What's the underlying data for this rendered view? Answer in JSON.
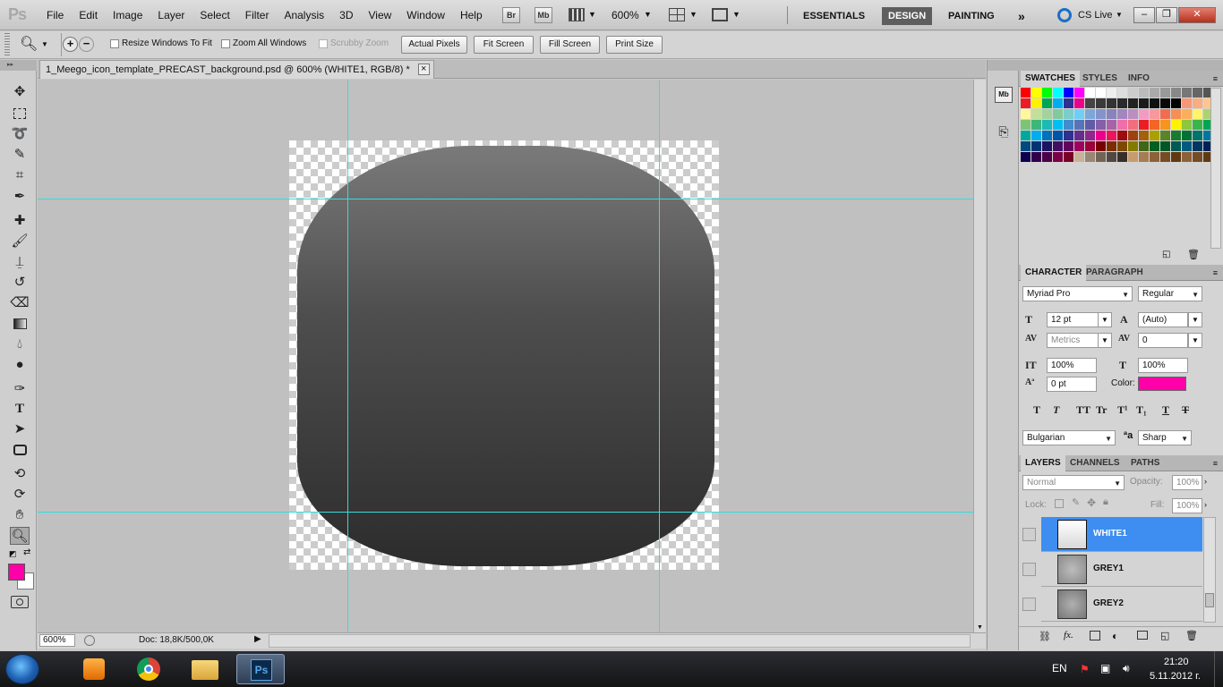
{
  "menubar": {
    "logo": "Ps",
    "menus": [
      "File",
      "Edit",
      "Image",
      "Layer",
      "Select",
      "Filter",
      "Analysis",
      "3D",
      "View",
      "Window",
      "Help"
    ],
    "bridge_btn": "Br",
    "minibridge_btn": "Mb",
    "zoom": "600%",
    "workspaces": [
      "ESSENTIALS",
      "DESIGN",
      "PAINTING"
    ],
    "more": "»",
    "cslive": "CS Live"
  },
  "options": {
    "resize_windows": "Resize Windows To Fit",
    "zoom_all": "Zoom All Windows",
    "scrubby_zoom": "Scrubby Zoom",
    "actual_pixels": "Actual Pixels",
    "fit_screen": "Fit Screen",
    "fill_screen": "Fill Screen",
    "print_size": "Print Size"
  },
  "document": {
    "tab_title": "1_Meego_icon_template_PRECAST_background.psd @ 600% (WHITE1, RGB/8) *",
    "close": "×"
  },
  "statusbar": {
    "zoom": "600%",
    "doc": "Doc: 18,8K/500,0K"
  },
  "tools": {
    "foreground_color": "#ff00a8",
    "background_color": "#ffffff"
  },
  "swatches": {
    "tabs": [
      "SWATCHES",
      "STYLES",
      "INFO"
    ]
  },
  "character": {
    "tabs": [
      "CHARACTER",
      "PARAGRAPH"
    ],
    "font_family": "Myriad Pro",
    "font_style": "Regular",
    "font_size": "12 pt",
    "leading": "(Auto)",
    "kerning": "Metrics",
    "tracking": "0",
    "vertical_scale": "100%",
    "horizontal_scale": "100%",
    "baseline_shift": "0 pt",
    "color_label": "Color:",
    "color": "#ff00a8",
    "language": "Bulgarian",
    "aa_glyph": "ªa",
    "antialias": "Sharp"
  },
  "layers": {
    "tabs": [
      "LAYERS",
      "CHANNELS",
      "PATHS"
    ],
    "blend_mode": "Normal",
    "opacity_label": "Opacity:",
    "opacity": "100%",
    "lock_label": "Lock:",
    "fill_label": "Fill:",
    "fill": "100%",
    "items": [
      {
        "name": "WHITE1",
        "selected": true
      },
      {
        "name": "GREY1",
        "selected": false
      },
      {
        "name": "GREY2",
        "selected": false
      }
    ]
  },
  "taskbar": {
    "language": "EN",
    "time": "21:20",
    "date": "5.11.2012 г."
  }
}
